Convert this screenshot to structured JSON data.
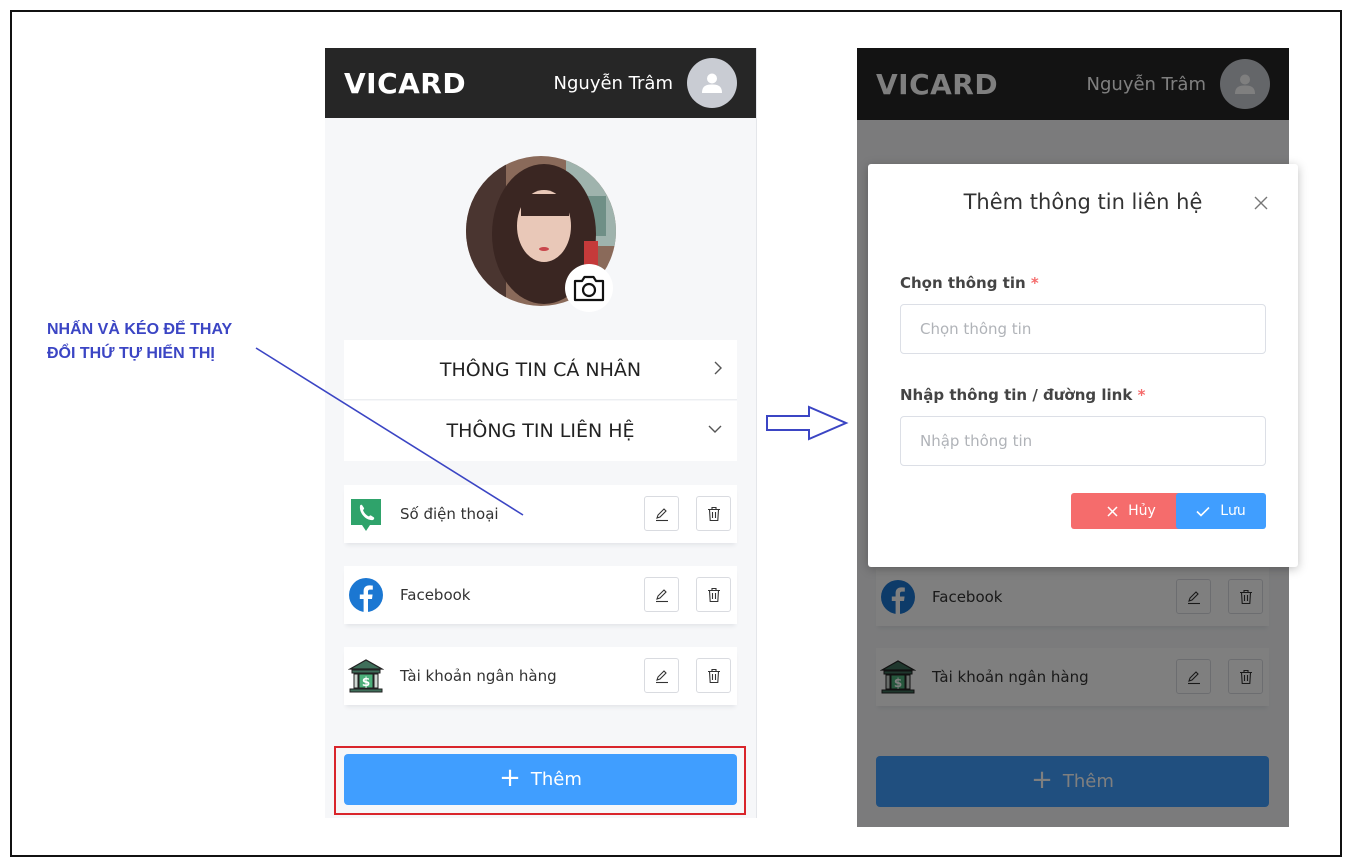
{
  "annotation": {
    "line1": "NHẤN VÀ KÉO ĐỂ THAY",
    "line2": "ĐỔI THỨ TỰ HIỂN THỊ"
  },
  "app": {
    "brand": "VICARD",
    "username": "Nguyễn Trâm"
  },
  "sections": {
    "personal": "THÔNG TIN CÁ NHÂN",
    "contact": "THÔNG TIN LIÊN HỆ"
  },
  "contacts": [
    {
      "label": "Số điện thoại",
      "icon": "phone-chat-icon"
    },
    {
      "label": "Facebook",
      "icon": "facebook-icon"
    },
    {
      "label": "Tài khoản ngân hàng",
      "icon": "bank-icon"
    }
  ],
  "add_button": {
    "label": "Thêm"
  },
  "modal": {
    "title": "Thêm thông tin liên hệ",
    "select_label": "Chọn thông tin",
    "select_placeholder": "Chọn thông tin",
    "input_label": "Nhập thông tin / đường link",
    "input_placeholder": "Nhập thông tin",
    "required_mark": "*",
    "cancel_label": "Hủy",
    "save_label": "Lưu"
  },
  "colors": {
    "primary": "#409eff",
    "danger": "#f56c6c",
    "header": "#262626",
    "annotation": "#3b45c4",
    "highlight": "#d9252b"
  }
}
